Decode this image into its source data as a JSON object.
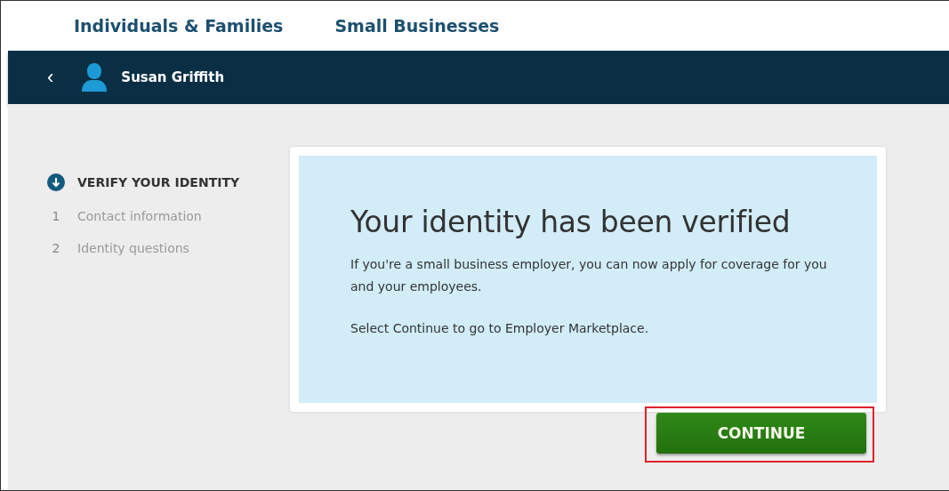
{
  "top_nav": [
    {
      "label": "Individuals & Families"
    },
    {
      "label": "Small Businesses"
    }
  ],
  "user_bar": {
    "back": "‹",
    "name": "Susan Griffith"
  },
  "steps": [
    {
      "kind": "heading",
      "label": "VERIFY YOUR IDENTITY"
    },
    {
      "kind": "step",
      "number": "1",
      "label": "Contact information"
    },
    {
      "kind": "step",
      "number": "2",
      "label": "Identity questions"
    }
  ],
  "message": {
    "title": "Your identity has been verified",
    "paragraphs": [
      "If you're a small business employer, you can now apply for coverage for you and your employees.",
      "Select Continue to go to Employer Marketplace."
    ]
  },
  "continue_button": {
    "label": "CONTINUE",
    "highlighted": true
  }
}
